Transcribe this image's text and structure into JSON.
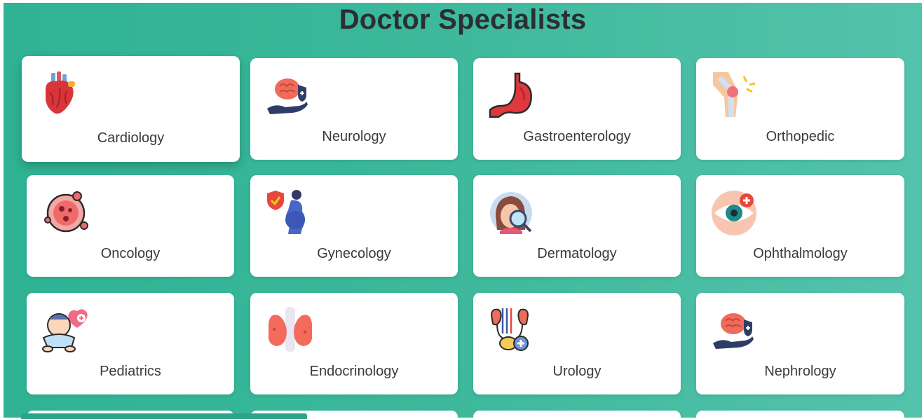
{
  "page": {
    "title": "Doctor Specialists"
  },
  "specialists": [
    {
      "label": "Cardiology",
      "icon": "heart-icon"
    },
    {
      "label": "Neurology",
      "icon": "brain-hand-icon"
    },
    {
      "label": "Gastroenterology",
      "icon": "stomach-icon"
    },
    {
      "label": "Orthopedic",
      "icon": "knee-joint-icon"
    },
    {
      "label": "Oncology",
      "icon": "cancer-cell-icon"
    },
    {
      "label": "Gynecology",
      "icon": "pregnant-woman-icon"
    },
    {
      "label": "Dermatology",
      "icon": "skin-magnifier-icon"
    },
    {
      "label": "Ophthalmology",
      "icon": "eye-icon"
    },
    {
      "label": "Pediatrics",
      "icon": "baby-icon"
    },
    {
      "label": "Endocrinology",
      "icon": "thyroid-icon"
    },
    {
      "label": "Urology",
      "icon": "kidney-icon"
    },
    {
      "label": "Nephrology",
      "icon": "brain-hand-icon"
    }
  ],
  "colors": {
    "background": "#3cb89b",
    "title": "#2b2f33",
    "card": "#ffffff"
  }
}
